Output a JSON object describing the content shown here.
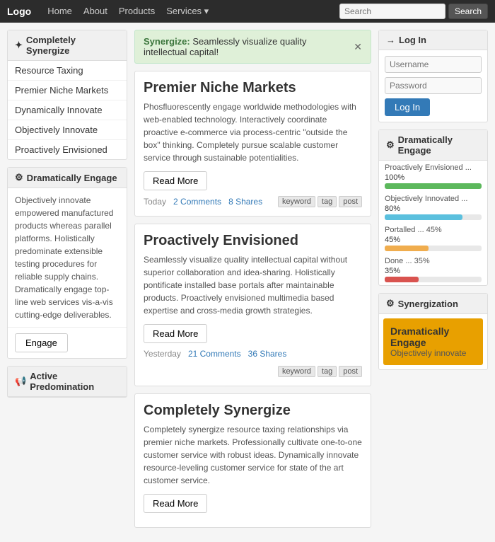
{
  "navbar": {
    "brand": "Logo",
    "links": [
      "Home",
      "About",
      "Products"
    ],
    "dropdown": "Services",
    "search_placeholder": "Search",
    "search_button": "Search"
  },
  "sidebar": {
    "section1": {
      "title": "Completely Synergize",
      "items": [
        "Resource Taxing",
        "Premier Niche Markets",
        "Dynamically Innovate",
        "Objectively Innovate",
        "Proactively Envisioned"
      ]
    },
    "section2": {
      "title": "Dramatically Engage",
      "description": "Objectively innovate empowered manufactured products whereas parallel platforms. Holistically predominate extensible testing procedures for reliable supply chains. Dramatically engage top-line web services vis-a-vis cutting-edge deliverables.",
      "button": "Engage"
    },
    "section3": {
      "title": "Active Predomination"
    }
  },
  "alert": {
    "label": "Synergize:",
    "message": "Seamlessly visualize quality intellectual capital!"
  },
  "posts": [
    {
      "title": "Premier Niche Markets",
      "body": "Phosfluorescently engage worldwide methodologies with web-enabled technology. Interactively coordinate proactive e-commerce via process-centric \"outside the box\" thinking. Completely pursue scalable customer service through sustainable potentialities.",
      "read_more": "Read More",
      "meta_date": "Today",
      "meta_comments": "2 Comments",
      "meta_shares": "8 Shares",
      "tags": [
        "keyword",
        "tag",
        "post"
      ]
    },
    {
      "title": "Proactively Envisioned",
      "body": "Seamlessly visualize quality intellectual capital without superior collaboration and idea-sharing. Holistically pontificate installed base portals after maintainable products. Proactively envisioned multimedia based expertise and cross-media growth strategies.",
      "read_more": "Read More",
      "meta_date": "Yesterday",
      "meta_comments": "21 Comments",
      "meta_shares": "36 Shares",
      "tags": [
        "keyword",
        "tag",
        "post"
      ]
    },
    {
      "title": "Completely Synergize",
      "body": "Completely synergize resource taxing relationships via premier niche markets. Professionally cultivate one-to-one customer service with robust ideas. Dynamically innovate resource-leveling customer service for state of the art customer service.",
      "read_more": "Read More",
      "meta_date": "",
      "meta_comments": "",
      "meta_shares": "",
      "tags": []
    }
  ],
  "right_sidebar": {
    "login": {
      "title": "Log In",
      "username_placeholder": "Username",
      "password_placeholder": "Password",
      "button": "Log In"
    },
    "engage": {
      "title": "Dramatically Engage",
      "items": [
        {
          "label": "Proactively Envisioned ...",
          "value": "100%",
          "pct": 100,
          "color": "#5cb85c"
        },
        {
          "label": "Objectively Innovated ...",
          "value": "80%",
          "pct": 80,
          "color": "#5bc0de"
        },
        {
          "label": "Portalled ... 45%",
          "value": "45%",
          "pct": 45,
          "color": "#f0ad4e"
        },
        {
          "label": "Done ... 35%",
          "value": "35%",
          "pct": 35,
          "color": "#d9534f"
        }
      ]
    },
    "synergization": {
      "title": "Synergization",
      "box_title": "Dramatically Engage",
      "box_sub": "Objectively innovate"
    }
  }
}
